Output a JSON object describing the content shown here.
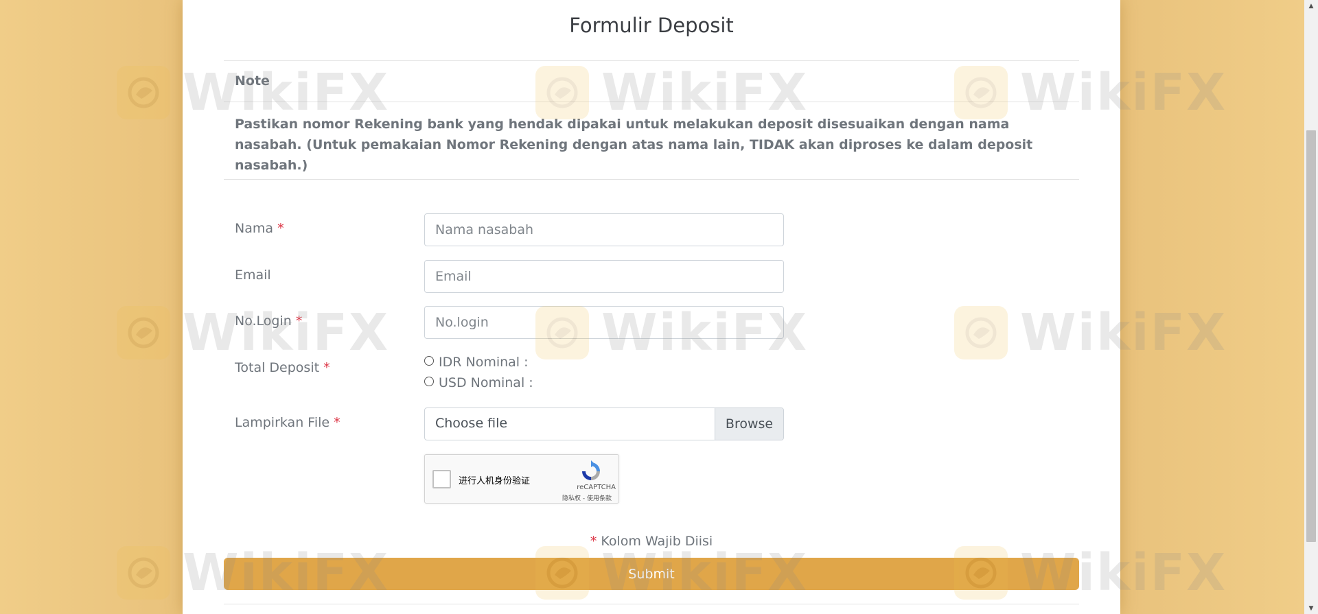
{
  "form": {
    "title": "Formulir Deposit",
    "note_label": "Note",
    "note_text": "Pastikan nomor Rekening bank yang hendak dipakai untuk melakukan deposit disesuaikan dengan nama nasabah. (Untuk pemakaian Nomor Rekening dengan atas nama lain, TIDAK akan diproses ke dalam deposit nasabah.)",
    "required_mark": "*",
    "fields": {
      "nama": {
        "label": "Nama",
        "placeholder": "Nama nasabah",
        "value": ""
      },
      "email": {
        "label": "Email",
        "placeholder": "Email",
        "value": ""
      },
      "login": {
        "label": "No.Login",
        "placeholder": "No.login",
        "value": ""
      },
      "deposit": {
        "label": "Total Deposit",
        "options": [
          "IDR Nominal :",
          "USD Nominal :"
        ]
      },
      "file": {
        "label": "Lampirkan File",
        "text": "Choose file",
        "button": "Browse"
      }
    },
    "captcha": {
      "label": "进行人机身份验证",
      "brand": "reCAPTCHA",
      "links": "隐私权 - 使用条款"
    },
    "required_note": "Kolom Wajib Diisi",
    "submit_label": "Submit"
  },
  "watermark": {
    "text": "WikiFX"
  },
  "colors": {
    "background": "#eecb86",
    "accent": "#e0a649",
    "required": "#dc3545"
  }
}
